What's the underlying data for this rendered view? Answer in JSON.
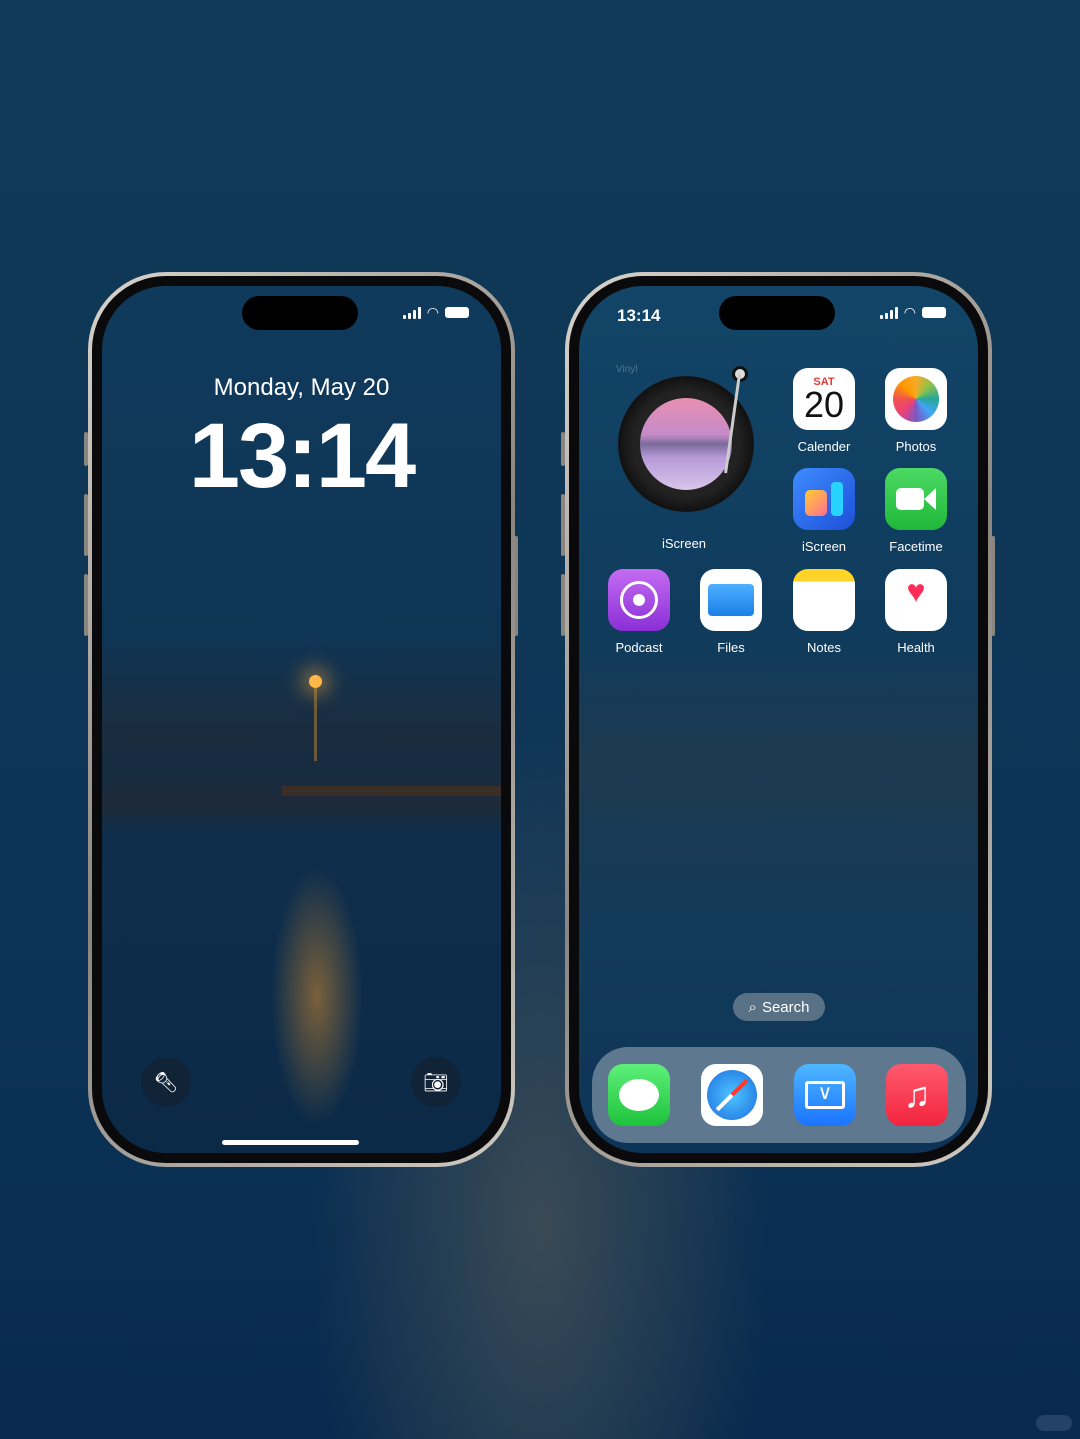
{
  "lock_screen": {
    "date": "Monday, May 20",
    "time": "13:14",
    "quick_actions": [
      {
        "icon": "flashlight-icon"
      },
      {
        "icon": "camera-icon"
      }
    ]
  },
  "home_screen": {
    "status_time": "13:14",
    "widget": {
      "label": "iScreen",
      "caption": "Vinyl"
    },
    "apps": [
      {
        "label": "Calender",
        "day": "SAT",
        "date": "20"
      },
      {
        "label": "Photos"
      },
      {
        "label": "iScreen"
      },
      {
        "label": "Facetime"
      },
      {
        "label": "Podcast"
      },
      {
        "label": "Files"
      },
      {
        "label": "Notes"
      },
      {
        "label": "Health"
      }
    ],
    "search_label": "Search",
    "dock": [
      {
        "icon": "messages-icon"
      },
      {
        "icon": "safari-icon"
      },
      {
        "icon": "mail-icon"
      },
      {
        "icon": "music-icon"
      }
    ]
  },
  "colors": {
    "background": "#0e3657",
    "calendar_red": "#e53935",
    "facetime_green": "#2ecc40",
    "podcast_purple": "#a14be0",
    "music_red": "#f2384e"
  }
}
